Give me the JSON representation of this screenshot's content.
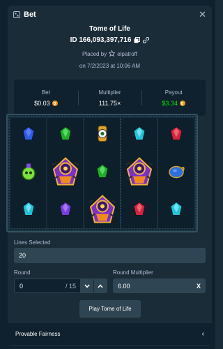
{
  "header": {
    "title": "Bet",
    "close_icon": "close-icon",
    "bet_icon": "bet-icon"
  },
  "game": {
    "name": "Tome of Life"
  },
  "bet": {
    "id_text": "ID 166,093,397,716",
    "placed_by_prefix": "Placed by",
    "user": "elpatroff",
    "date_text": "on 7/2/2023 at 10:06 AM"
  },
  "stats": {
    "bet_label": "Bet",
    "bet_value": "$0.03",
    "multiplier_label": "Multiplier",
    "multiplier_value": "111.75×",
    "payout_label": "Payout",
    "payout_value": "$3.34",
    "payout_color": "#00e701",
    "currency_color": "#f7931a"
  },
  "reels": {
    "columns": [
      [
        "blue-gem",
        "green-potion",
        "cyan-gem"
      ],
      [
        "green-gem",
        "pharaoh",
        "purple-gem"
      ],
      [
        "eye-totem",
        "green-gem",
        "pharaoh"
      ],
      [
        "cyan-gem",
        "pharaoh",
        "red-gem"
      ],
      [
        "red-gem",
        "blue-urn",
        "cyan-gem"
      ]
    ]
  },
  "form": {
    "lines_label": "Lines Selected",
    "lines_value": "20",
    "round_label": "Round",
    "round_value": "0",
    "round_of": "/ 15",
    "round_multiplier_label": "Round Multiplier",
    "round_multiplier_value": "6.00",
    "x_symbol": "X"
  },
  "play_button": "Play Tome of Life",
  "provable_fairness": "Provable Fairness"
}
